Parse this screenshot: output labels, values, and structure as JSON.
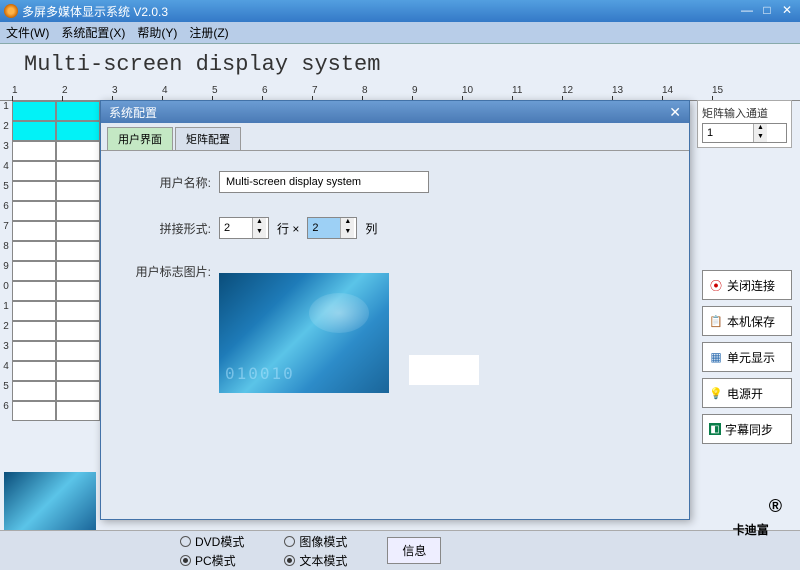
{
  "titlebar": {
    "text": "多屏多媒体显示系统  V2.0.3"
  },
  "menu": {
    "file": "文件(W)",
    "config": "系统配置(X)",
    "help": "帮助(Y)",
    "register": "注册(Z)"
  },
  "main_title": "Multi-screen display system",
  "ruler_marks": [
    "1",
    "2",
    "3",
    "4",
    "5",
    "6",
    "7",
    "8",
    "9",
    "10",
    "11",
    "12",
    "13",
    "14",
    "15"
  ],
  "grid_rows": [
    "1",
    "2",
    "3",
    "4",
    "5",
    "6",
    "7",
    "8",
    "9",
    "0",
    "1",
    "2",
    "3",
    "4",
    "5",
    "6"
  ],
  "dialog": {
    "title": "系统配置",
    "tabs": {
      "ui": "用户界面",
      "matrix": "矩阵配置"
    },
    "username_label": "用户名称:",
    "username_value": "Multi-screen display system",
    "splice_label": "拼接形式:",
    "rows_value": "2",
    "rows_suffix": "行 ×",
    "cols_value": "2",
    "cols_suffix": "列",
    "logo_label": "用户标志图片:"
  },
  "right": {
    "matrix_input_label": "矩阵输入通道",
    "matrix_input_value": "1"
  },
  "buttons": {
    "close_conn": "关闭连接",
    "local_save": "本机保存",
    "unit_display": "单元显示",
    "power_on": "电源开",
    "subtitle_sync": "字幕同步"
  },
  "bottom": {
    "mode1_a": "DVD模式",
    "mode1_b": "PC模式",
    "mode2_a": "图像模式",
    "mode2_b": "文本模式",
    "info": "信息"
  },
  "watermark": "卡迪富",
  "icons": {
    "close_conn": "⦿",
    "save": "📋",
    "grid": "▦",
    "bulb": "💡",
    "sync": "◧"
  },
  "colors": {
    "close_conn": "#c00",
    "save": "#c00",
    "grid": "#2b6cb0",
    "bulb": "#d4a000",
    "sync": "#0a7d4a"
  }
}
